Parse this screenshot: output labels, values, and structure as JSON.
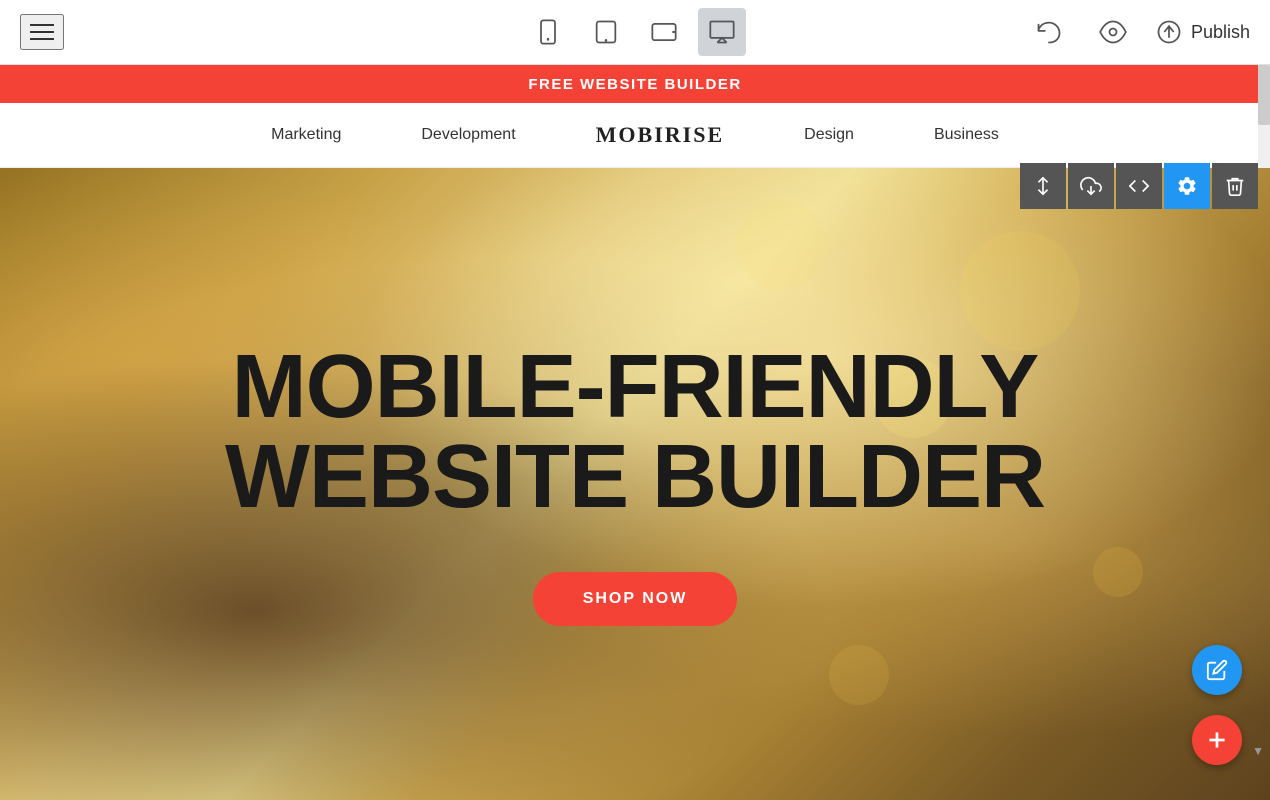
{
  "toolbar": {
    "publish_label": "Publish",
    "devices": [
      {
        "id": "mobile",
        "label": "Mobile view",
        "active": false
      },
      {
        "id": "tablet",
        "label": "Tablet view",
        "active": false
      },
      {
        "id": "tablet-landscape",
        "label": "Tablet landscape view",
        "active": false
      },
      {
        "id": "desktop",
        "label": "Desktop view",
        "active": true
      }
    ]
  },
  "banner": {
    "text": "FREE WEBSITE BUILDER"
  },
  "navbar": {
    "links": [
      {
        "label": "Marketing"
      },
      {
        "label": "Development"
      },
      {
        "label": "MOBIRISE",
        "brand": true
      },
      {
        "label": "Design"
      },
      {
        "label": "Business"
      }
    ]
  },
  "hero": {
    "title_line1": "MOBILE-FRIENDLY",
    "title_line2": "WEBSITE BUILDER",
    "button_label": "SHOP NOW"
  },
  "block_controls": [
    {
      "id": "move",
      "label": "Move block"
    },
    {
      "id": "download",
      "label": "Save block"
    },
    {
      "id": "code",
      "label": "Edit code"
    },
    {
      "id": "settings",
      "label": "Block settings",
      "active": true
    },
    {
      "id": "delete",
      "label": "Delete block"
    }
  ],
  "fabs": {
    "pencil_label": "Edit",
    "add_label": "Add block"
  }
}
